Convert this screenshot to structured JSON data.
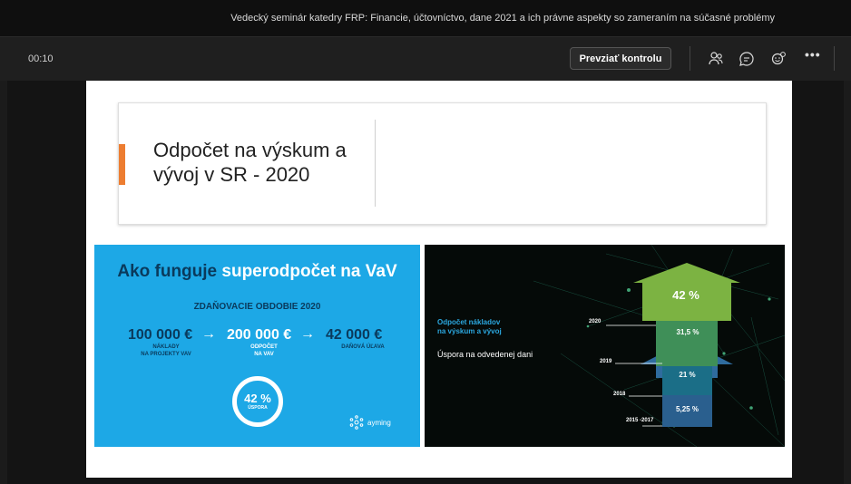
{
  "window": {
    "title": "Vedecký seminár katedry FRP: Financie, účtovníctvo, dane 2021 a ich právne aspekty so zameraním na súčasné problémy"
  },
  "toolbar": {
    "timer": "00:10",
    "take_control_label": "Prevziať kontrolu",
    "icons": [
      "participants-icon",
      "chat-icon",
      "reactions-icon",
      "more-options-icon"
    ],
    "more_label": "•••"
  },
  "slide": {
    "title_line1": "Odpočet na výskum a",
    "title_line2": "vývoj  v SR - 2020",
    "accent_color": "#ed7d31",
    "left_panel": {
      "heading_part1": "Ako funguje",
      "heading_part2": "superodpočet na VaV",
      "period": "ZDAŇOVACIE OBDOBIE 2020",
      "amount1": "100 000 €",
      "amount2": "200 000 €",
      "amount3": "42 000 €",
      "arrow": "→",
      "label1_line1": "NÁKLADY",
      "label1_line2": "NA PROJEKTY VAV",
      "label2_line1": "ODPOČET",
      "label2_line2": "NA VAV",
      "label3": "DAŇOVÁ ÚĽAVA",
      "ring_percent": "42 %",
      "ring_label": "ÚSPORA",
      "brand": "ayming",
      "background": "#1da8e6"
    },
    "right_panel": {
      "title_line1": "Odpočet nákladov",
      "title_line2": "na výskum a vývoj",
      "subtitle": "Úspora na odvedenej dani",
      "steps": [
        {
          "year": "2020",
          "percent": "42 %"
        },
        {
          "year": "2019",
          "percent": "31,5 %"
        },
        {
          "year": "2018",
          "percent": "21 %"
        },
        {
          "year": "2015 -2017",
          "percent": "5,25 %"
        }
      ]
    }
  }
}
